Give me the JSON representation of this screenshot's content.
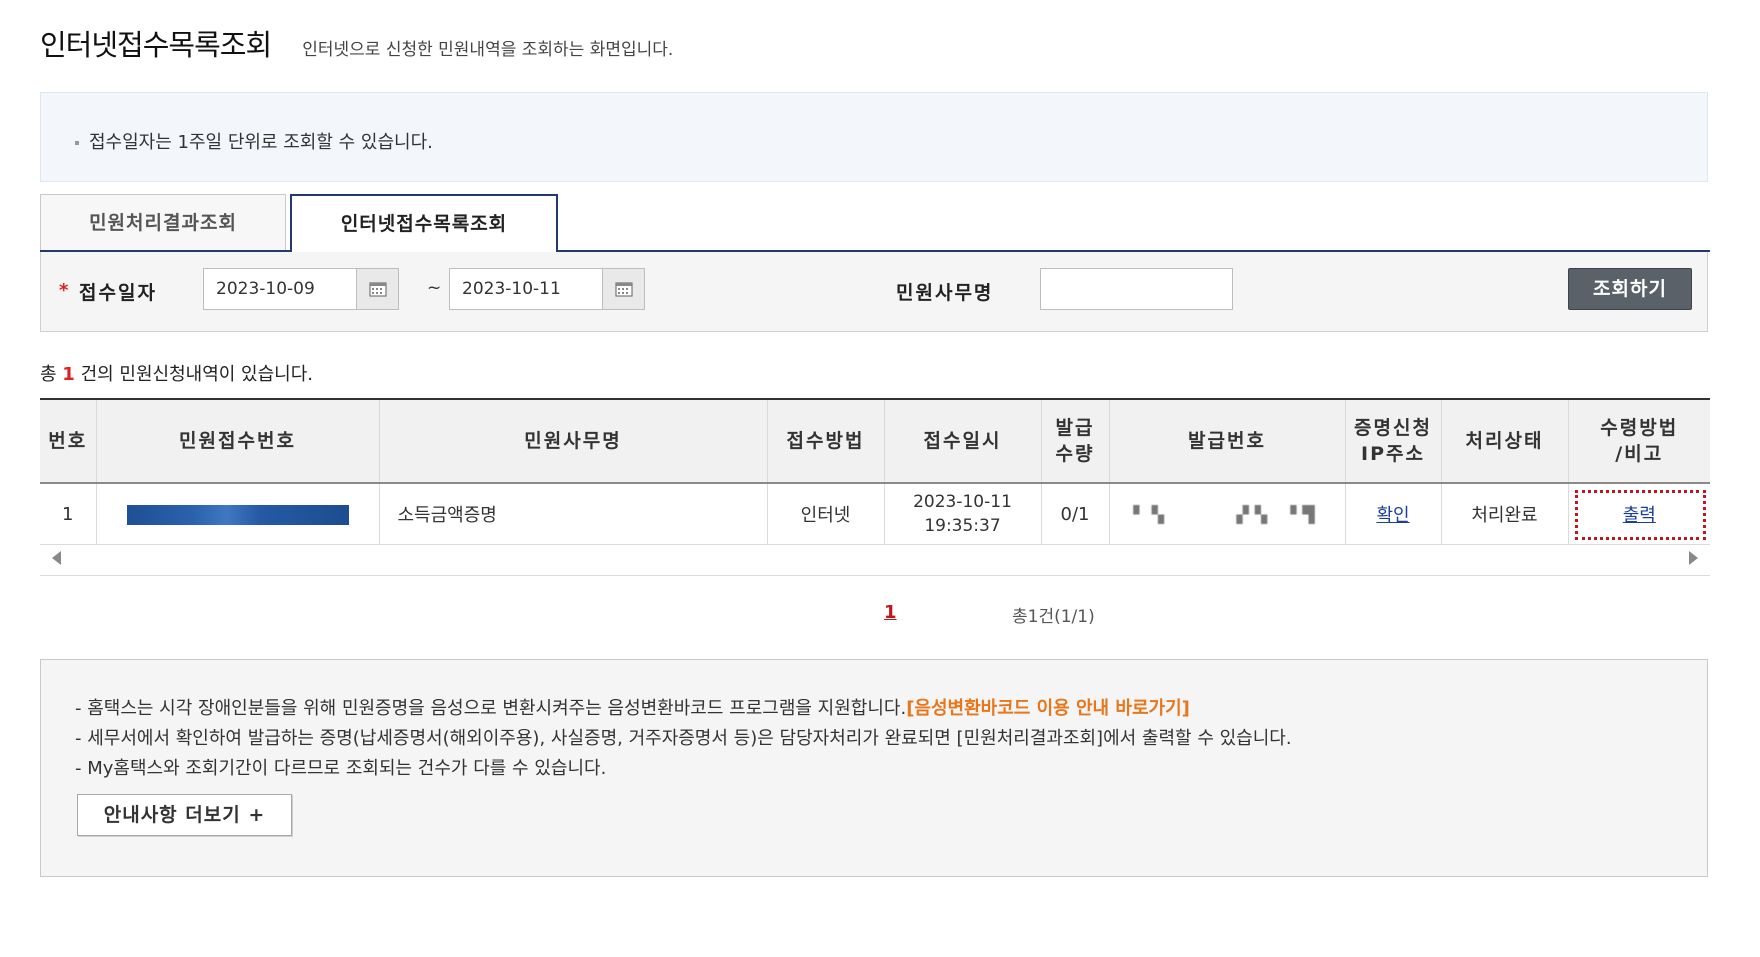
{
  "header": {
    "title": "인터넷접수목록조회",
    "subtitle": "인터넷으로 신청한 민원내역을 조회하는 화면입니다."
  },
  "notice": {
    "text": "접수일자는 1주일 단위로 조회할 수 있습니다."
  },
  "tabs": [
    {
      "label": "민원처리결과조회",
      "active": false
    },
    {
      "label": "인터넷접수목록조회",
      "active": true
    }
  ],
  "search": {
    "required_mark": "*",
    "date_label": "접수일자",
    "start_date": "2023-10-09",
    "separator": "~",
    "end_date": "2023-10-11",
    "name_label": "민원사무명",
    "name_value": "",
    "button_label": "조회하기"
  },
  "summary": {
    "prefix": "총",
    "count": "1",
    "suffix": "건의 민원신청내역이 있습니다."
  },
  "table": {
    "headers": {
      "no": "번호",
      "receipt_no": "민원접수번호",
      "service_name": "민원사무명",
      "method": "접수방법",
      "datetime": "접수일시",
      "qty_line1": "발급",
      "qty_line2": "수량",
      "issue_no": "발급번호",
      "ip_line1": "증명신청",
      "ip_line2": "IP주소",
      "status": "처리상태",
      "receive_line1": "수령방법",
      "receive_line2": "/비고"
    },
    "rows": [
      {
        "no": "1",
        "service_name": "소득금액증명",
        "method": "인터넷",
        "date": "2023-10-11",
        "time": "19:35:37",
        "qty": "0/1",
        "ip_link": "확인",
        "status": "처리완료",
        "receive_link": "출력"
      }
    ]
  },
  "pagination": {
    "current": "1",
    "total_text": "총1건(1/1)"
  },
  "info": {
    "line1": "- 홈택스는 시각 장애인분들을 위해 민원증명을 음성으로 변환시켜주는 음성변환바코드 프로그램을 지원합니다.",
    "line1_link": "[음성변환바코드 이용 안내 바로가기]",
    "line2": "- 세무서에서 확인하여 발급하는 증명(납세증명서(해외이주용), 사실증명, 거주자증명서 등)은 담당자처리가 완료되면 [민원처리결과조회]에서 출력할 수 있습니다.",
    "line3": "- My홈택스와 조회기간이 다르므로 조회되는 건수가 다를 수 있습니다.",
    "more_button": "안내사항 더보기 +"
  },
  "colors": {
    "tab_border": "#243a6b",
    "highlight": "#c0161e",
    "link": "#1b3f9a",
    "orange_link": "#e8761b",
    "search_button": "#5b6168"
  }
}
